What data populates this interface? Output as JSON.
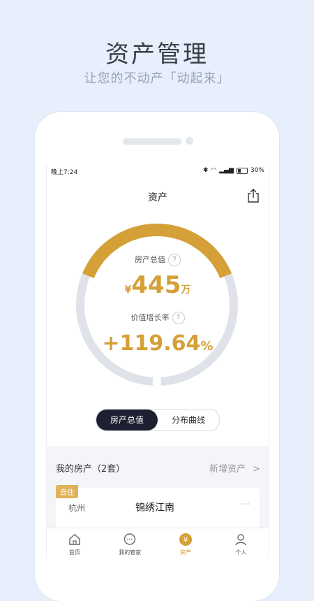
{
  "promo": {
    "title": "资产管理",
    "subtitle": "让您的不动产「动起来」"
  },
  "status": {
    "time": "晚上7:24",
    "battery": "30%"
  },
  "nav": {
    "title": "资产"
  },
  "summary": {
    "total_label": "房产总值",
    "total_currency": "¥",
    "total_value": "445",
    "total_unit": "万",
    "growth_label": "价值增长率",
    "growth_value": "+119.64",
    "growth_unit": "%",
    "help": "?",
    "gauge_fill_fraction": 0.38
  },
  "toggle": {
    "active": "房产总值",
    "inactive": "分布曲线"
  },
  "section": {
    "title": "我的房产（2套）",
    "add": "新增资产",
    "chevron": ">"
  },
  "property": {
    "tag": "自住",
    "city": "杭州",
    "name": "锦绣江南",
    "more": "···"
  },
  "tabs": [
    {
      "label": "首页",
      "icon": "home-icon"
    },
    {
      "label": "我的管家",
      "icon": "chat-icon"
    },
    {
      "label": "资产",
      "icon": "yen-icon"
    },
    {
      "label": "个人",
      "icon": "user-icon"
    }
  ],
  "colors": {
    "accent": "#d4a037",
    "track": "#dfe2e8",
    "dark": "#1d2030"
  }
}
